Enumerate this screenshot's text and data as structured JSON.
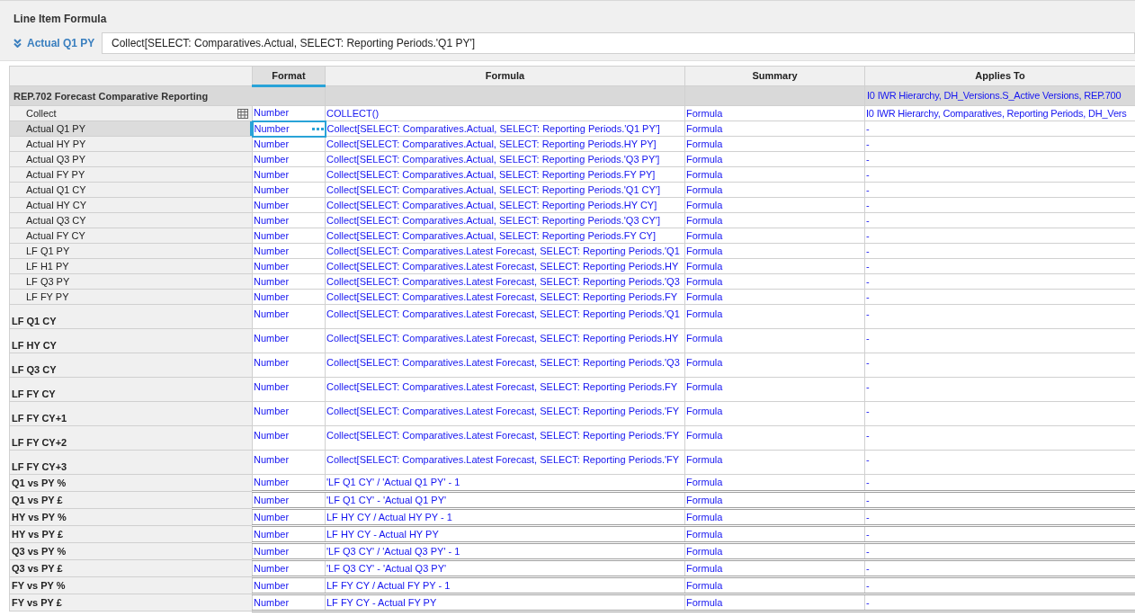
{
  "panel": {
    "title": "Line Item Formula",
    "item": "Actual Q1 PY",
    "formula": "Collect[SELECT: Comparatives.Actual, SELECT: Reporting Periods.'Q1 PY']"
  },
  "table": {
    "columns": [
      {
        "label": "Format",
        "selected": true
      },
      {
        "label": "Formula",
        "selected": false
      },
      {
        "label": "Summary",
        "selected": false
      },
      {
        "label": "Applies To",
        "selected": false
      }
    ],
    "rows": [
      {
        "kind": "group",
        "name": "REP.702 Forecast Comparative Reporting",
        "applies_to": "I0 IWR Hierarchy, DH_Versions.S_Active Versions, REP.700",
        "selected": false
      },
      {
        "kind": "list",
        "name": "Collect",
        "format": "Number",
        "formula": "COLLECT()",
        "summary": "Formula",
        "applies_to": "I0 IWR Hierarchy, Comparatives, Reporting Periods, DH_Vers",
        "selected": false
      },
      {
        "kind": "item",
        "name": "Actual Q1 PY",
        "format": "Number",
        "formula": "Collect[SELECT: Comparatives.Actual, SELECT: Reporting Periods.'Q1 PY']",
        "summary": "Formula",
        "applies_to": "-",
        "selected": true
      },
      {
        "kind": "item",
        "name": "Actual HY PY",
        "format": "Number",
        "formula": "Collect[SELECT: Comparatives.Actual, SELECT: Reporting Periods.HY PY]",
        "summary": "Formula",
        "applies_to": "-",
        "selected": false
      },
      {
        "kind": "item",
        "name": "Actual Q3 PY",
        "format": "Number",
        "formula": "Collect[SELECT: Comparatives.Actual, SELECT: Reporting Periods.'Q3 PY']",
        "summary": "Formula",
        "applies_to": "-",
        "selected": false
      },
      {
        "kind": "item",
        "name": "Actual FY PY",
        "format": "Number",
        "formula": "Collect[SELECT: Comparatives.Actual, SELECT: Reporting Periods.FY PY]",
        "summary": "Formula",
        "applies_to": "-",
        "selected": false
      },
      {
        "kind": "item",
        "name": "Actual Q1 CY",
        "format": "Number",
        "formula": "Collect[SELECT: Comparatives.Actual, SELECT: Reporting Periods.'Q1 CY']",
        "summary": "Formula",
        "applies_to": "-",
        "selected": false
      },
      {
        "kind": "item",
        "name": "Actual HY CY",
        "format": "Number",
        "formula": "Collect[SELECT: Comparatives.Actual, SELECT: Reporting Periods.HY CY]",
        "summary": "Formula",
        "applies_to": "-",
        "selected": false
      },
      {
        "kind": "item",
        "name": "Actual Q3 CY",
        "format": "Number",
        "formula": "Collect[SELECT: Comparatives.Actual, SELECT: Reporting Periods.'Q3 CY']",
        "summary": "Formula",
        "applies_to": "-",
        "selected": false
      },
      {
        "kind": "item",
        "name": "Actual FY CY",
        "format": "Number",
        "formula": "Collect[SELECT: Comparatives.Actual, SELECT: Reporting Periods.FY CY]",
        "summary": "Formula",
        "applies_to": "-",
        "selected": false
      },
      {
        "kind": "item",
        "name": "LF Q1 PY",
        "format": "Number",
        "formula": "Collect[SELECT: Comparatives.Latest Forecast, SELECT: Reporting Periods.'Q1",
        "summary": "Formula",
        "applies_to": "-",
        "selected": false
      },
      {
        "kind": "item",
        "name": "LF H1 PY",
        "format": "Number",
        "formula": "Collect[SELECT: Comparatives.Latest Forecast, SELECT: Reporting Periods.HY",
        "summary": "Formula",
        "applies_to": "-",
        "selected": false
      },
      {
        "kind": "item",
        "name": "LF Q3 PY",
        "format": "Number",
        "formula": "Collect[SELECT: Comparatives.Latest Forecast, SELECT: Reporting Periods.'Q3",
        "summary": "Formula",
        "applies_to": "-",
        "selected": false
      },
      {
        "kind": "item",
        "name": "LF FY PY",
        "format": "Number",
        "formula": "Collect[SELECT: Comparatives.Latest Forecast, SELECT: Reporting Periods.FY",
        "summary": "Formula",
        "applies_to": "-",
        "selected": false
      },
      {
        "kind": "tall",
        "name": "LF Q1 CY",
        "format": "Number",
        "formula": "Collect[SELECT: Comparatives.Latest Forecast, SELECT: Reporting Periods.'Q1",
        "summary": "Formula",
        "applies_to": "-",
        "selected": false
      },
      {
        "kind": "tall",
        "name": "LF HY CY",
        "format": "Number",
        "formula": "Collect[SELECT: Comparatives.Latest Forecast, SELECT: Reporting Periods.HY",
        "summary": "Formula",
        "applies_to": "-",
        "selected": false
      },
      {
        "kind": "tall",
        "name": "LF Q3 CY",
        "format": "Number",
        "formula": "Collect[SELECT: Comparatives.Latest Forecast, SELECT: Reporting Periods.'Q3",
        "summary": "Formula",
        "applies_to": "-",
        "selected": false
      },
      {
        "kind": "tall",
        "name": "LF FY CY",
        "format": "Number",
        "formula": "Collect[SELECT: Comparatives.Latest Forecast, SELECT: Reporting Periods.FY",
        "summary": "Formula",
        "applies_to": "-",
        "selected": false
      },
      {
        "kind": "tall",
        "name": "LF FY CY+1",
        "format": "Number",
        "formula": "Collect[SELECT: Comparatives.Latest Forecast, SELECT: Reporting Periods.'FY",
        "summary": "Formula",
        "applies_to": "-",
        "selected": false
      },
      {
        "kind": "tall",
        "name": "LF FY CY+2",
        "format": "Number",
        "formula": "Collect[SELECT: Comparatives.Latest Forecast, SELECT: Reporting Periods.'FY",
        "summary": "Formula",
        "applies_to": "-",
        "selected": false
      },
      {
        "kind": "tall",
        "name": "LF FY CY+3",
        "format": "Number",
        "formula": "Collect[SELECT: Comparatives.Latest Forecast, SELECT: Reporting Periods.'FY",
        "summary": "Formula",
        "applies_to": "-",
        "selected": false
      },
      {
        "kind": "calc",
        "name": "Q1 vs PY %",
        "format": "Number",
        "formula": "'LF Q1 CY' / 'Actual Q1 PY' - 1",
        "summary": "Formula",
        "applies_to": "-",
        "selected": false
      },
      {
        "kind": "calc",
        "name": "Q1 vs PY £",
        "format": "Number",
        "formula": "'LF Q1 CY' - 'Actual Q1 PY'",
        "summary": "Formula",
        "applies_to": "-",
        "selected": false
      },
      {
        "kind": "calc",
        "name": "HY vs PY %",
        "format": "Number",
        "formula": "LF HY CY / Actual HY PY - 1",
        "summary": "Formula",
        "applies_to": "-",
        "selected": false
      },
      {
        "kind": "calc",
        "name": "HY vs PY £",
        "format": "Number",
        "formula": "LF HY CY - Actual HY PY",
        "summary": "Formula",
        "applies_to": "-",
        "selected": false
      },
      {
        "kind": "calc",
        "name": "Q3 vs PY %",
        "format": "Number",
        "formula": "'LF Q3 CY' / 'Actual Q3 PY' - 1",
        "summary": "Formula",
        "applies_to": "-",
        "selected": false
      },
      {
        "kind": "calc",
        "name": "Q3 vs PY £",
        "format": "Number",
        "formula": "'LF Q3 CY' - 'Actual Q3 PY'",
        "summary": "Formula",
        "applies_to": "-",
        "selected": false
      },
      {
        "kind": "calc",
        "name": "FY vs PY %",
        "format": "Number",
        "formula": "LF FY CY / Actual FY PY - 1",
        "summary": "Formula",
        "applies_to": "-",
        "selected": false
      },
      {
        "kind": "calc",
        "name": "FY vs PY £",
        "format": "Number",
        "formula": "LF FY CY - Actual FY PY",
        "summary": "Formula",
        "applies_to": "-",
        "selected": false
      }
    ]
  }
}
